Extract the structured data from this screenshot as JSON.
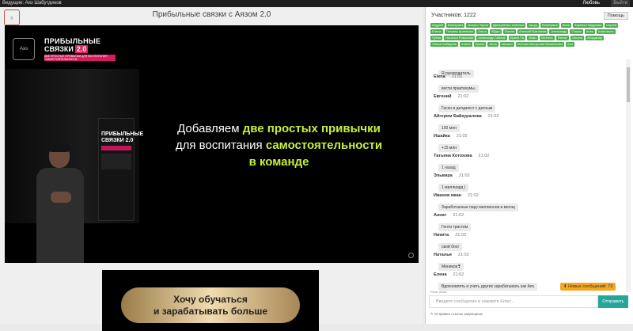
{
  "topbar": {
    "host": "Ведущие: Аяз Шабутдинов",
    "link": "Любовь",
    "button": "Выйти"
  },
  "logo": "♁",
  "title": "Прибыльные связки с Аязом 2.0",
  "video": {
    "brand_emblem": "Аяз",
    "brand_line1": "ПРИБЫЛЬНЫЕ",
    "brand_line2": "СВЯЗКИ",
    "brand_version": "2.0",
    "brand_tagline": "ДВЕ ПРОСТЫХ ПРИВЫЧКИ ДЛЯ ВОСПИТАНИЯ САМОСТОЯТЕЛЬНОСТИ",
    "screen_line1": "ПРИБЫЛЬНЫЕ",
    "screen_line2": "СВЯЗКИ 2.0",
    "caption_1": "Добавляем ",
    "caption_hl_1": "две простых привычки",
    "caption_2": "для воспитания ",
    "caption_hl_2": "самостоятельности",
    "caption_hl_3": "в команде"
  },
  "promo": {
    "line1": "Хочу обучаться",
    "line2": "и зарабатывать больше"
  },
  "chat": {
    "participants_label": "Участников: 1222",
    "help_label": "Помощь",
    "participants": [
      "Андрей",
      "Екатерина",
      "Алексо Тирон",
      "Дмитриенко Наталья",
      "Артур",
      "Екатерина",
      "Анна",
      "Зарема Гайдукова",
      "Сергей",
      "Елена",
      "Татьяна Артемова",
      "Ольга",
      "Айдос",
      "Елена",
      "Алексей Бакланов",
      "Александр",
      "Олжас",
      "Анна",
      "Анастасия",
      "Чуева",
      "Наталья Романова",
      "Александр Гайлов",
      "Ирина Ра",
      "Иван",
      "Евгения",
      "Фатим",
      "Оксана",
      "Владимир",
      "Элина Лебедева",
      "Алена",
      "Ирина",
      "Анна",
      "Михаил",
      "Ксения Белоусова Мишенкова",
      "Ани"
    ],
    "first_bubble": "Я руководитель",
    "messages": [
      {
        "name": "Elena",
        "time": "21:02",
        "text": "вести практикумы,"
      },
      {
        "name": "Евгений",
        "time": "21:02",
        "text": "Гасач и дилджент с датным"
      },
      {
        "name": "Айгерим Байкуралова",
        "time": "21:02",
        "text": "100 млн"
      },
      {
        "name": "Ишайка",
        "time": "21:02",
        "text": "+15 млн"
      },
      {
        "name": "Татьяна Котохова",
        "time": "21:02",
        "text": "1 назад"
      },
      {
        "name": "Эльвира",
        "time": "21:02",
        "text": "1 миллиард )"
      },
      {
        "name": "Иванов иван",
        "time": "21:02",
        "text": "Заработанные пару миллионов в месяц"
      },
      {
        "name": "Аннат",
        "time": "21:02",
        "text": "Генти тристим"
      },
      {
        "name": "Никита",
        "time": "21:02",
        "text": "свой блог"
      },
      {
        "name": "Наталья",
        "time": "21:02",
        "text": "Миников❣"
      },
      {
        "name": "Елена",
        "time": "21:02",
        "text": "Вдохновлять и учить других зарабатывать как Аяз"
      }
    ],
    "new_messages": "⬇ Новых сообщений: 73",
    "typing": "Роза: Анна",
    "input_placeholder": "Введите сообщение и нажмите Enter...",
    "send_label": "Отправить",
    "footer": "✎ Отправка ссылок запрещена."
  }
}
